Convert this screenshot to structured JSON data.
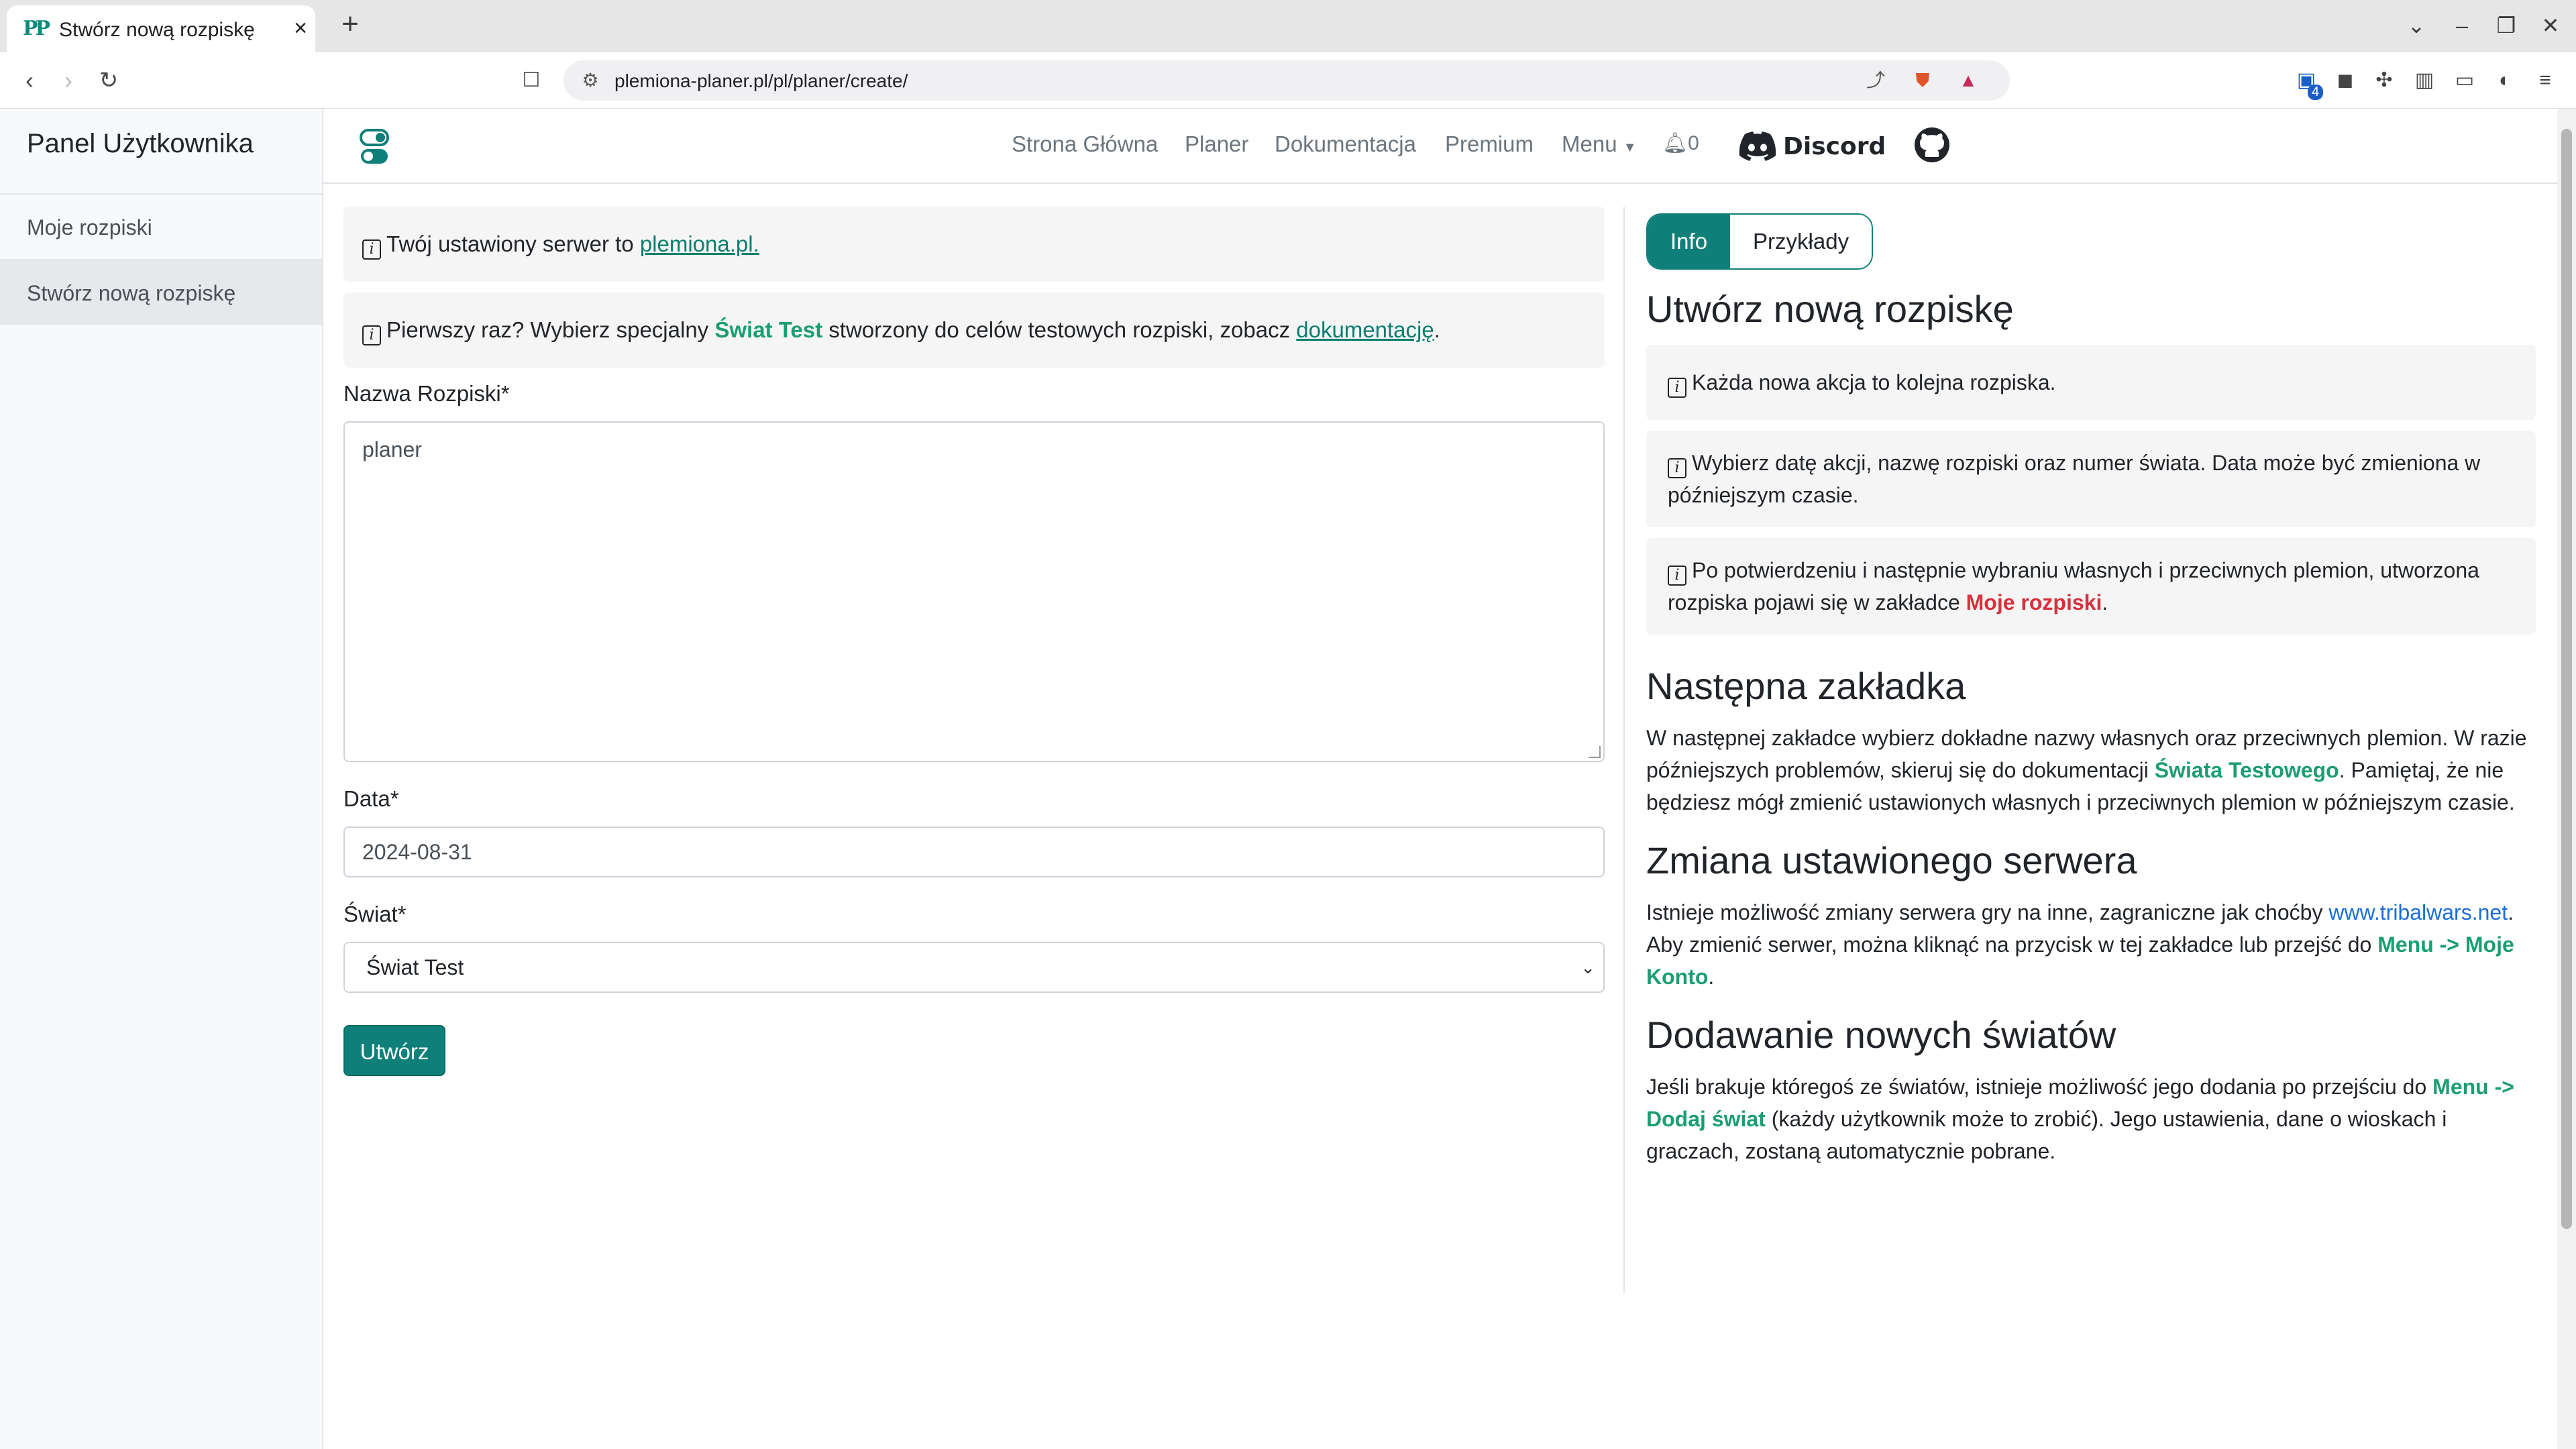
{
  "browser": {
    "tab_title": "Stwórz nową rozpiskę",
    "favicon_text": "PP",
    "url": "plemiona-planer.pl/pl/planer/create/",
    "extension_badge": "4"
  },
  "sidebar": {
    "heading": "Panel Użytkownika",
    "items": [
      {
        "label": "Moje rozpiski",
        "active": false
      },
      {
        "label": "Stwórz nową rozpiskę",
        "active": true
      }
    ]
  },
  "nav": {
    "links": [
      "Strona Główna",
      "Planer",
      "Dokumentacja",
      "Premium",
      "Menu"
    ],
    "notifications_count": "0",
    "discord_label": "Discord"
  },
  "form": {
    "server_info_prefix": "Twój ustawiony serwer to ",
    "server_link": "plemiona.pl.",
    "first_time_prefix": "Pierwszy raz? Wybierz specjalny ",
    "first_time_world": "Świat Test",
    "first_time_middle": " stworzony do celów testowych rozpiski, zobacz ",
    "first_time_link": "dokumentację",
    "first_time_suffix": ".",
    "name_label": "Nazwa Rozpiski*",
    "name_value": "planer",
    "date_label": "Data*",
    "date_value": "2024-08-31",
    "world_label": "Świat*",
    "world_value": "Świat Test",
    "submit_label": "Utwórz"
  },
  "info_panel": {
    "tabs": [
      {
        "label": "Info",
        "active": true
      },
      {
        "label": "Przykłady",
        "active": false
      }
    ],
    "heading_create": "Utwórz nową rozpiskę",
    "box1": "Każda nowa akcja to kolejna rozpiska.",
    "box2": "Wybierz datę akcji, nazwę rozpiski oraz numer świata. Data może być zmieniona w późniejszym czasie.",
    "box3_prefix": "Po potwierdzeniu i następnie wybraniu własnych i przeciwnych plemion, utworzona rozpiska pojawi się w zakładce ",
    "box3_link": "Moje rozpiski",
    "box3_suffix": ".",
    "heading_next": "Następna zakładka",
    "next_prefix": "W następnej zakładce wybierz dokładne nazwy własnych oraz przeciwnych plemion. W razie późniejszych problemów, skieruj się do dokumentacji ",
    "next_link": "Świata Testowego",
    "next_suffix": ". Pamiętaj, że nie będziesz mógł zmienić ustawionych własnych i przeciwnych plemion w późniejszym czasie.",
    "heading_server": "Zmiana ustawionego serwera",
    "server_prefix": "Istnieje możliwość zmiany serwera gry na inne, zagraniczne jak choćby ",
    "server_link": "www.tribalwars.net",
    "server_middle": ". Aby zmienić serwer, można kliknąć na przycisk w tej zakładce lub przejść do ",
    "server_menu_link": "Menu -> Moje Konto",
    "server_suffix": ".",
    "heading_worlds": "Dodawanie nowych światów",
    "worlds_prefix": "Jeśli brakuje któregoś ze światów, istnieje możliwość jego dodania po przejściu do ",
    "worlds_link": "Menu -> Dodaj świat",
    "worlds_suffix": " (każdy użytkownik może to zrobić). Jego ustawienia, dane o wioskach i graczach, zostaną automatycznie pobrane."
  },
  "colors": {
    "accent": "#0f8079",
    "link_green": "#1a9e72",
    "link_red": "#d8303c",
    "link_blue": "#1a6ed8"
  }
}
